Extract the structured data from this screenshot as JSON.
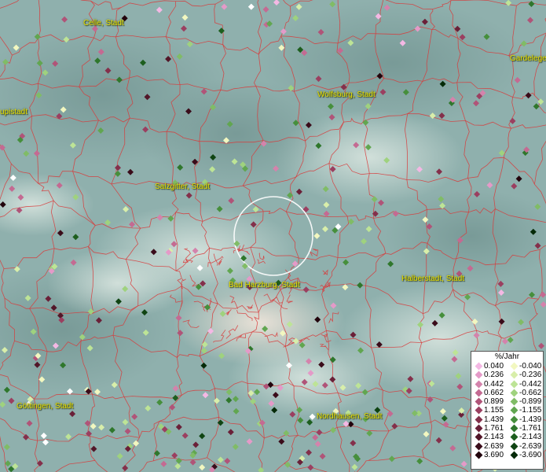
{
  "map": {
    "cities": [
      {
        "name": "Celle, Stadt"
      },
      {
        "name": "Gardelegen"
      },
      {
        "name": "upistadt"
      },
      {
        "name": "Wolfsburg, Stadt"
      },
      {
        "name": "Salzgitter, Stadt"
      },
      {
        "name": "Bad Harzburg, Stadt"
      },
      {
        "name": "Halberstadt, Stadt"
      },
      {
        "name": "Göttingen, Stadt"
      },
      {
        "name": "Nordhausen, Stadt"
      }
    ],
    "colors": {
      "background": "#8fb0ad",
      "border_lines": "#d83a3a",
      "city_labels": "#e8e000",
      "highlight_circle": "#ffffff"
    }
  },
  "legend": {
    "title": "%/Jahr",
    "positive": [
      {
        "label": "0.040",
        "color": "#f4b8e4"
      },
      {
        "label": "0.236",
        "color": "#e49ac8"
      },
      {
        "label": "0.442",
        "color": "#d483ac"
      },
      {
        "label": "0.662",
        "color": "#c46a92"
      },
      {
        "label": "0.899",
        "color": "#b05478"
      },
      {
        "label": "1.155",
        "color": "#9b3f60"
      },
      {
        "label": "1.439",
        "color": "#84304b"
      },
      {
        "label": "1.761",
        "color": "#6a2038"
      },
      {
        "label": "2.143",
        "color": "#521628"
      },
      {
        "label": "2.639",
        "color": "#3a0c1a"
      },
      {
        "label": "3.690",
        "color": "#22040c"
      }
    ],
    "negative": [
      {
        "label": "-0.040",
        "color": "#f2f7c0"
      },
      {
        "label": "-0.236",
        "color": "#d8eeaa"
      },
      {
        "label": "-0.442",
        "color": "#bde496"
      },
      {
        "label": "-0.662",
        "color": "#9fd27e"
      },
      {
        "label": "-0.899",
        "color": "#80bc66"
      },
      {
        "label": "-1.155",
        "color": "#61a650"
      },
      {
        "label": "-1.439",
        "color": "#468f3c"
      },
      {
        "label": "-1.761",
        "color": "#2f772c"
      },
      {
        "label": "-2.143",
        "color": "#1d5e1e"
      },
      {
        "label": "-2.639",
        "color": "#0f4412"
      },
      {
        "label": "-3.690",
        "color": "#052a08"
      }
    ]
  }
}
